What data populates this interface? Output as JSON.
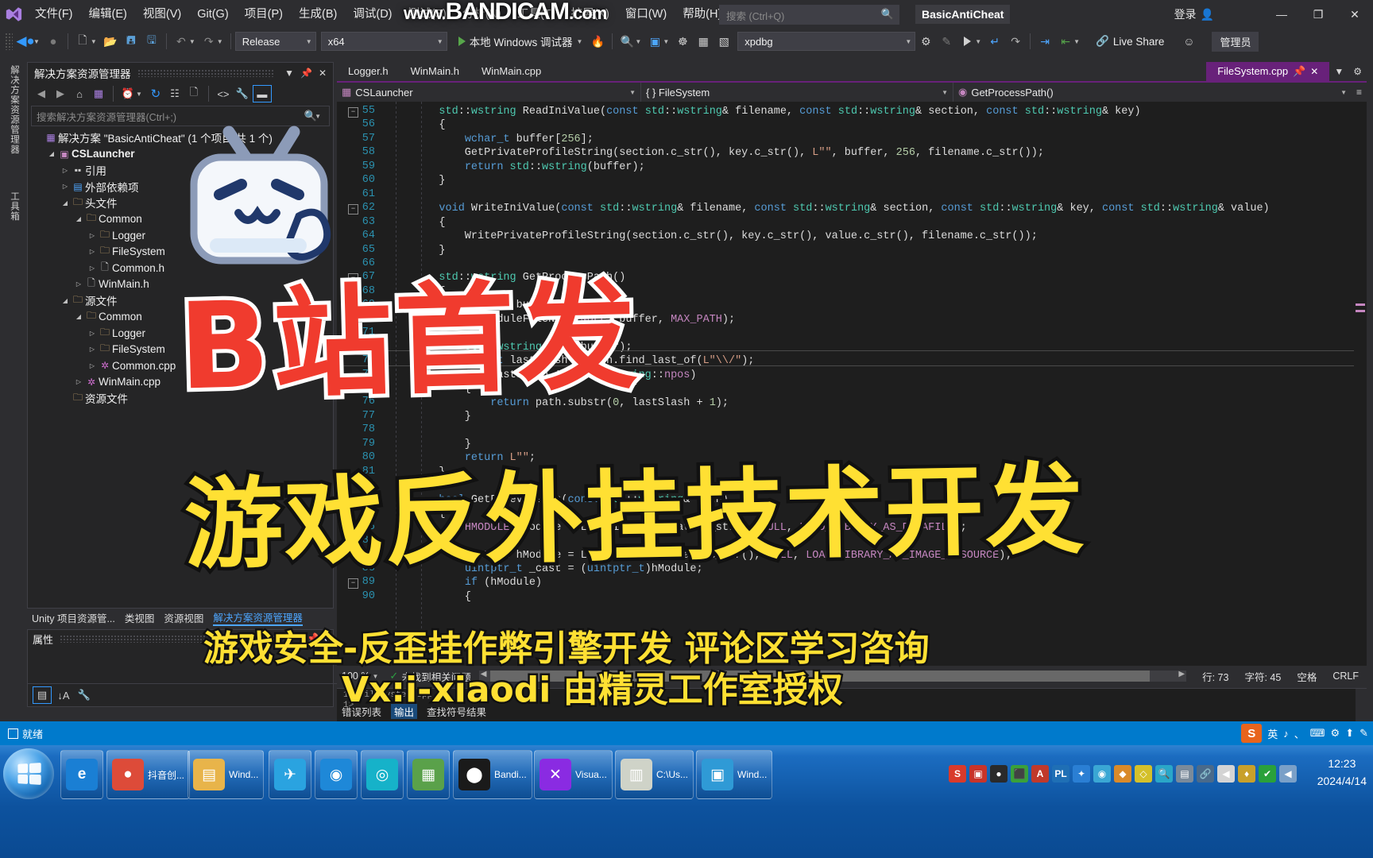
{
  "titlebar": {
    "menus": [
      "文件(F)",
      "编辑(E)",
      "视图(V)",
      "Git(G)",
      "项目(P)",
      "生成(B)",
      "调试(D)",
      "测试(S)",
      "分析(N)",
      "工具(T)",
      "扩展(X)",
      "窗口(W)",
      "帮助(H)"
    ],
    "search_placeholder": "搜索 (Ctrl+Q)",
    "window_title": "BasicAntiCheat",
    "signin": "登录",
    "minimize": "—",
    "maximize": "❐",
    "close": "✕"
  },
  "toolbar": {
    "configuration": "Release",
    "platform": "x64",
    "run_label": "本地 Windows 调试器",
    "process_combo": "xpdbg",
    "live_share": "Live Share",
    "admin_label": "管理员"
  },
  "vertical_tabs": [
    "解决方案资源管理器",
    "工具箱"
  ],
  "solution_explorer": {
    "title": "解决方案资源管理器",
    "search_placeholder": "搜索解决方案资源管理器(Ctrl+;)",
    "solution_node": "解决方案 \"BasicAntiCheat\" (1 个项目/共 1 个)",
    "tree": [
      {
        "depth": 1,
        "arrow": "open",
        "icon": "project-icon",
        "label": "CSLauncher",
        "bold": true,
        "kind": "project"
      },
      {
        "depth": 2,
        "arrow": "closed",
        "icon": "references-icon",
        "label": "引用",
        "kind": "ref"
      },
      {
        "depth": 2,
        "arrow": "closed",
        "icon": "ext-dep-icon",
        "label": "外部依赖项",
        "kind": "ext"
      },
      {
        "depth": 2,
        "arrow": "open",
        "icon": "filter-folder-icon",
        "label": "头文件",
        "kind": "folder"
      },
      {
        "depth": 3,
        "arrow": "open",
        "icon": "filter-folder-icon",
        "label": "Common",
        "kind": "folder"
      },
      {
        "depth": 4,
        "arrow": "closed",
        "icon": "filter-folder-icon",
        "label": "Logger",
        "kind": "folder"
      },
      {
        "depth": 4,
        "arrow": "closed",
        "icon": "filter-folder-icon",
        "label": "FileSystem",
        "kind": "folder"
      },
      {
        "depth": 4,
        "arrow": "closed",
        "icon": "header-file-icon",
        "label": "Common.h",
        "kind": "header"
      },
      {
        "depth": 3,
        "arrow": "closed",
        "icon": "header-file-icon",
        "label": "WinMain.h",
        "kind": "header"
      },
      {
        "depth": 2,
        "arrow": "open",
        "icon": "filter-folder-icon",
        "label": "源文件",
        "kind": "folder"
      },
      {
        "depth": 3,
        "arrow": "open",
        "icon": "filter-folder-icon",
        "label": "Common",
        "kind": "folder"
      },
      {
        "depth": 4,
        "arrow": "closed",
        "icon": "filter-folder-icon",
        "label": "Logger",
        "kind": "folder"
      },
      {
        "depth": 4,
        "arrow": "closed",
        "icon": "filter-folder-icon",
        "label": "FileSystem",
        "kind": "folder"
      },
      {
        "depth": 4,
        "arrow": "closed",
        "icon": "cpp-file-icon",
        "label": "Common.cpp",
        "kind": "cpp"
      },
      {
        "depth": 3,
        "arrow": "closed",
        "icon": "cpp-file-icon",
        "label": "WinMain.cpp",
        "kind": "cpp"
      },
      {
        "depth": 2,
        "arrow": "none",
        "icon": "filter-folder-icon",
        "label": "资源文件",
        "kind": "folder"
      }
    ],
    "bottom_tabs": [
      {
        "label": "Unity 项目资源管...",
        "active": false
      },
      {
        "label": "类视图",
        "active": false
      },
      {
        "label": "资源视图",
        "active": false
      },
      {
        "label": "解决方案资源管理器",
        "active": true
      }
    ]
  },
  "properties_pane": {
    "title": "属性"
  },
  "editor": {
    "tabs": [
      {
        "label": "Logger.h",
        "active": false
      },
      {
        "label": "WinMain.h",
        "active": false
      },
      {
        "label": "WinMain.cpp",
        "active": false
      },
      {
        "label": "FileSystem.cpp",
        "active": true
      }
    ],
    "nav_project": "CSLauncher",
    "nav_scope": "{ } FileSystem",
    "nav_member": "GetProcessPath()",
    "first_line_number": 55,
    "lines": [
      {
        "n": 55,
        "text": "    std::wstring ReadIniValue(const std::wstring& filename, const std::wstring& section, const std::wstring& key)",
        "fold": "collapse"
      },
      {
        "n": 56,
        "text": "    {"
      },
      {
        "n": 57,
        "text": "        wchar_t buffer[256];"
      },
      {
        "n": 58,
        "text": "        GetPrivateProfileString(section.c_str(), key.c_str(), L\"\", buffer, 256, filename.c_str());"
      },
      {
        "n": 59,
        "text": "        return std::wstring(buffer);"
      },
      {
        "n": 60,
        "text": "    }"
      },
      {
        "n": 61,
        "text": ""
      },
      {
        "n": 62,
        "text": "    void WriteIniValue(const std::wstring& filename, const std::wstring& section, const std::wstring& key, const std::wstring& value)",
        "fold": "collapse"
      },
      {
        "n": 63,
        "text": "    {"
      },
      {
        "n": 64,
        "text": "        WritePrivateProfileString(section.c_str(), key.c_str(), value.c_str(), filename.c_str());"
      },
      {
        "n": 65,
        "text": "    }"
      },
      {
        "n": 66,
        "text": ""
      },
      {
        "n": 67,
        "text": "    std::wstring GetProcessPath()",
        "fold": "collapse"
      },
      {
        "n": 68,
        "text": "    {"
      },
      {
        "n": 69,
        "text": "        wchar_t buffer[MAX_PATH];"
      },
      {
        "n": 70,
        "text": "        GetModuleFileName(NULL, buffer, MAX_PATH);"
      },
      {
        "n": 71,
        "text": ""
      },
      {
        "n": 72,
        "text": "        std::wstring path(buffer);"
      },
      {
        "n": 73,
        "text": "        size_t lastSlash = path.find_last_of(L\"\\\\/\");"
      },
      {
        "n": 74,
        "text": "        if (lastSlash != std::wstring::npos)"
      },
      {
        "n": 75,
        "text": "        {"
      },
      {
        "n": 76,
        "text": "            return path.substr(0, lastSlash + 1);"
      },
      {
        "n": 77,
        "text": "        }"
      },
      {
        "n": 78,
        "text": ""
      },
      {
        "n": 79,
        "text": "        }"
      },
      {
        "n": 80,
        "text": "        return L\"\";"
      },
      {
        "n": 81,
        "text": "    }"
      },
      {
        "n": 82,
        "text": ""
      },
      {
        "n": 83,
        "text": "    bool GetFileVersion(const std::wstring& path)",
        "fold": "collapse"
      },
      {
        "n": 84,
        "text": "    {"
      },
      {
        "n": 85,
        "text": "        HMODULE hModule = LoadLibraryEx(path.c_str(), NULL, LOAD_LIBRARY_AS_DATAFILE);"
      },
      {
        "n": 86,
        "text": ""
      },
      {
        "n": 87,
        "text": "        HMODULE hModule = LoadLibraryExW(path.c_str(), NULL, LOAD_LIBRARY_AS_IMAGE_RESOURCE);"
      },
      {
        "n": 88,
        "text": "        uintptr_t _cast = (uintptr_t)hModule;"
      },
      {
        "n": 89,
        "text": "        if (hModule)",
        "fold": "collapse"
      },
      {
        "n": 90,
        "text": "        {"
      }
    ],
    "status": {
      "zoom": "100 %",
      "issues": "未找到相关问题",
      "line": "行: 73",
      "col": "字符: 45",
      "spaces": "空格",
      "eol": "CRLF"
    }
  },
  "output_pane": {
    "lines": [
      "1>  FileSystem.cpp",
      "1>"
    ],
    "tabs": [
      {
        "label": "错误列表",
        "active": false
      },
      {
        "label": "输出",
        "active": true
      },
      {
        "label": "查找符号结果",
        "active": false
      }
    ]
  },
  "vs_status_bar": {
    "ready": "就绪"
  },
  "taskbar": {
    "items": [
      {
        "name": "internet-explorer",
        "label": "",
        "short": "",
        "color": "#1a7fd4",
        "glyph": "e",
        "pinned": true
      },
      {
        "name": "chrome-douyin",
        "label": "抖音创...",
        "short": "抖音创...",
        "color": "#dd4b39",
        "glyph": "●",
        "pinned": false
      },
      {
        "name": "windows-explorer",
        "label": "Wind...",
        "short": "Wind...",
        "color": "#e8b44a",
        "glyph": "▤",
        "pinned": false
      },
      {
        "name": "telegram",
        "label": "",
        "short": "",
        "color": "#2aa3e0",
        "glyph": "✈",
        "pinned": true
      },
      {
        "name": "app-blue-circle",
        "label": "",
        "short": "",
        "color": "#1e88d8",
        "glyph": "◉",
        "pinned": true
      },
      {
        "name": "app-teal-circle",
        "label": "",
        "short": "",
        "color": "#16b2c9",
        "glyph": "◎",
        "pinned": true
      },
      {
        "name": "minecraft",
        "label": "",
        "short": "",
        "color": "#5aa14a",
        "glyph": "▦",
        "pinned": true
      },
      {
        "name": "bandicam",
        "label": "Bandi...",
        "short": "Bandi...",
        "color": "#1a1a1a",
        "glyph": "⬤",
        "pinned": false
      },
      {
        "name": "visual-studio",
        "label": "Visua...",
        "short": "Visua...",
        "color": "#8a2be2",
        "glyph": "✕",
        "pinned": false
      },
      {
        "name": "cmd-console",
        "label": "C:\\Us...",
        "short": "C:\\Us...",
        "color": "#cfd3c8",
        "glyph": "▥",
        "pinned": false
      },
      {
        "name": "windows-explorer-2",
        "label": "Wind...",
        "short": "Wind...",
        "color": "#2f9ad6",
        "glyph": "▣",
        "pinned": false
      }
    ],
    "tray": [
      "S",
      "▣",
      "●",
      "⬛",
      "A",
      "PL",
      "✦",
      "◉",
      "◆",
      "◇",
      "🔍",
      "▤",
      "🔗",
      "◀",
      "♦",
      "✔",
      "◀"
    ],
    "clock_time": "12:23",
    "clock_date": "2024/4/14"
  },
  "overlays": {
    "bandicam_watermark": "www.BANDICAM.com",
    "big_red": "B站首发",
    "big_yellow": "游戏反外挂技术开发",
    "subtitle1": "游戏安全-反歪挂作弊引擎开发 评论区学习咨询",
    "subtitle2": "Vx:i-xiaodi 由精灵工作室授权"
  },
  "colors": {
    "accent_purple": "#68217a",
    "status_blue": "#007acc",
    "editor_bg": "#1e1e1e",
    "chrome_bg": "#2d2d30",
    "red_title": "#f03b2e",
    "yellow_title": "#ffe033"
  }
}
